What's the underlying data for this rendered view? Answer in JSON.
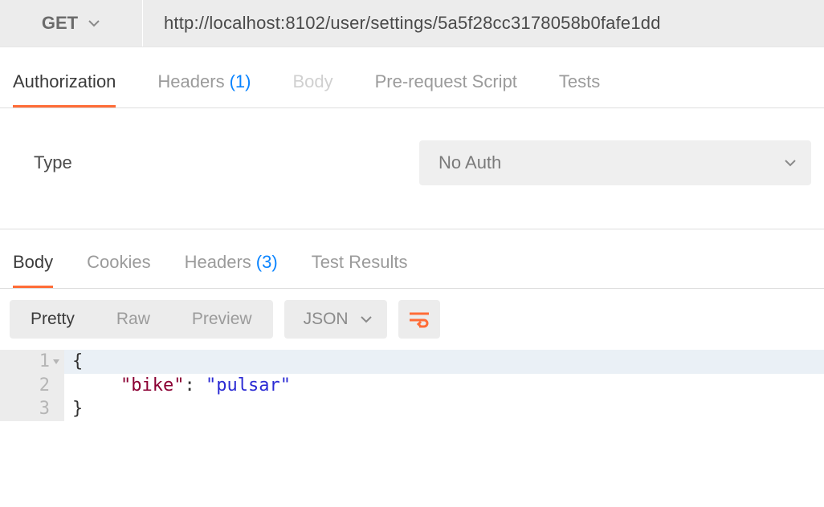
{
  "request": {
    "method": "GET",
    "url": "http://localhost:8102/user/settings/5a5f28cc3178058b0fafe1dd"
  },
  "request_tabs": {
    "authorization": "Authorization",
    "headers": "Headers",
    "headers_count": "(1)",
    "body": "Body",
    "prerequest": "Pre-request Script",
    "tests": "Tests"
  },
  "auth": {
    "type_label": "Type",
    "selected": "No Auth"
  },
  "response_tabs": {
    "body": "Body",
    "cookies": "Cookies",
    "headers": "Headers",
    "headers_count": "(3)",
    "test_results": "Test Results"
  },
  "view_modes": {
    "pretty": "Pretty",
    "raw": "Raw",
    "preview": "Preview",
    "format": "JSON"
  },
  "response_body": {
    "lines": [
      "{",
      "    \"bike\": \"pulsar\"",
      "}"
    ],
    "line_numbers": [
      "1",
      "2",
      "3"
    ],
    "json": {
      "bike": "pulsar"
    },
    "tokens": {
      "open": "{",
      "key": "\"bike\"",
      "colon": ": ",
      "value": "\"pulsar\"",
      "close": "}"
    }
  }
}
